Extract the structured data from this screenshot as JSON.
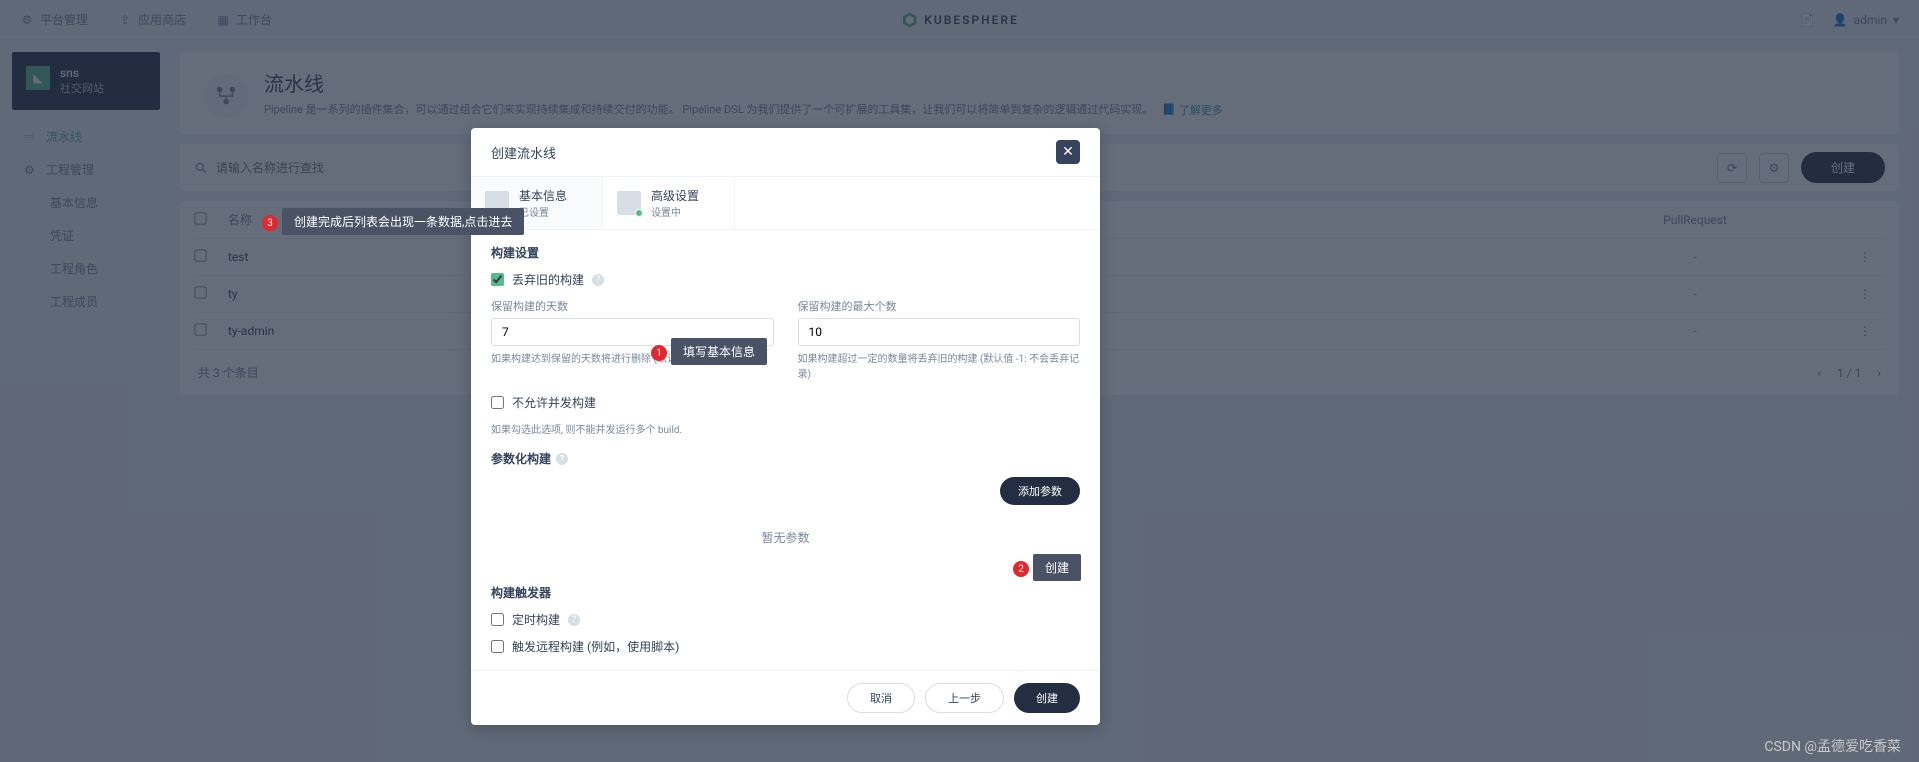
{
  "topbar": {
    "platform": "平台管理",
    "appstore": "应用商店",
    "workbench": "工作台",
    "brand": "KUBESPHERE",
    "user": "admin"
  },
  "sidebar": {
    "project": {
      "name": "sns",
      "desc": "社交网站"
    },
    "items": [
      {
        "icon": "flow",
        "label": "流水线",
        "active": true
      },
      {
        "icon": "settings",
        "label": "工程管理",
        "active": false
      }
    ],
    "sub": [
      "基本信息",
      "凭证",
      "工程角色",
      "工程成员"
    ]
  },
  "header": {
    "title": "流水线",
    "desc": "Pipeline 是一系列的插件集合，可以通过组合它们来实现持续集成和持续交付的功能。 Pipeline DSL 为我们提供了一个可扩展的工具集，让我们可以将简单到复杂的逻辑通过代码实现。",
    "more": "了解更多"
  },
  "toolbar": {
    "searchPlaceholder": "请输入名称进行查找",
    "createBtn": "创建"
  },
  "table": {
    "headers": {
      "name": "名称",
      "pr": "PullRequest"
    },
    "rows": [
      {
        "name": "test",
        "pr": "-"
      },
      {
        "name": "ty",
        "pr": "-"
      },
      {
        "name": "ty-admin",
        "pr": "-"
      }
    ]
  },
  "paging": {
    "total": "共 3 个条目",
    "pages": "1 / 1"
  },
  "modal": {
    "title": "创建流水线",
    "tabs": [
      {
        "title": "基本信息",
        "sub": "已设置",
        "active": false
      },
      {
        "title": "高级设置",
        "sub": "设置中",
        "active": true
      }
    ],
    "build": {
      "section": "构建设置",
      "discard": "丢弃旧的构建",
      "daysLabel": "保留构建的天数",
      "daysValue": "7",
      "daysHint": "如果构建达到保留的天数将进行删除 (默认值 -1: 不会丢弃记录)",
      "maxLabel": "保留构建的最大个数",
      "maxValue": "10",
      "maxHint": "如果构建超过一定的数量将丢弃旧的构建 (默认值 -1: 不会丢弃记录)",
      "noConcLabel": "不允许并发构建",
      "noConcHint": "如果勾选此选项, 则不能并发运行多个 build."
    },
    "param": {
      "section": "参数化构建",
      "add": "添加参数",
      "empty": "暂无参数"
    },
    "trigger": {
      "section": "构建触发器",
      "scheduled": "定时构建",
      "remote": "触发远程构建 (例如，使用脚本)"
    },
    "footer": {
      "cancel": "取消",
      "prev": "上一步",
      "create": "创建"
    }
  },
  "annotations": {
    "a1": {
      "num": "1",
      "text": "填写基本信息"
    },
    "a2": {
      "num": "2",
      "text": "创建"
    },
    "a3": {
      "num": "3",
      "text": "创建完成后列表会出现一条数据,点击进去"
    }
  },
  "watermark": "CSDN @孟德爱吃香菜"
}
